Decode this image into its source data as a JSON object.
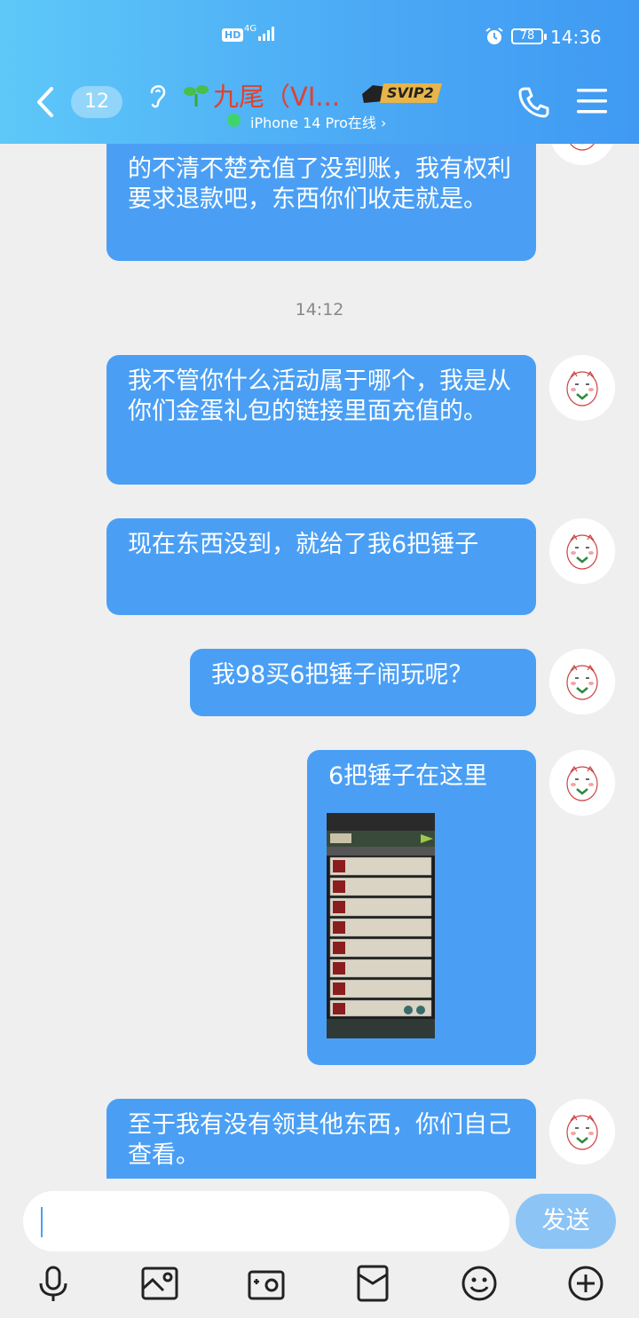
{
  "status_bar": {
    "hd": "HD",
    "network": "4G",
    "battery": "78",
    "time": "14:36"
  },
  "header": {
    "unread_count": "12",
    "contact_name": "九尾（VI...",
    "vip_label": "SVIP2",
    "online_status": "iPhone 14 Pro在线 ›"
  },
  "messages": [
    {
      "text": "的不清不楚充值了没到账，我有权利要求退款吧，东西你们收走就是。"
    },
    {
      "text": "我不管你什么活动属于哪个，我是从你们金蛋礼包的链接里面充值的。"
    },
    {
      "text": "现在东西没到，就给了我6把锤子"
    },
    {
      "text": "我98买6把锤子闹玩呢？"
    },
    {
      "text": "6把锤子在这里"
    },
    {
      "text": "至于我有没有领其他东西，你们自己查看。"
    }
  ],
  "timestamp": "14:12",
  "input": {
    "value": "",
    "send_label": "发送"
  },
  "toolbar": {
    "icons": [
      "microphone-icon",
      "photo-icon",
      "camera-icon",
      "red-packet-icon",
      "emoji-icon",
      "plus-icon"
    ]
  },
  "colors": {
    "bubble": "#4a9ff5",
    "header_start": "#5ec8f8",
    "header_end": "#3f9af2",
    "name": "#e2402e",
    "send_button": "#8cc4f6"
  }
}
